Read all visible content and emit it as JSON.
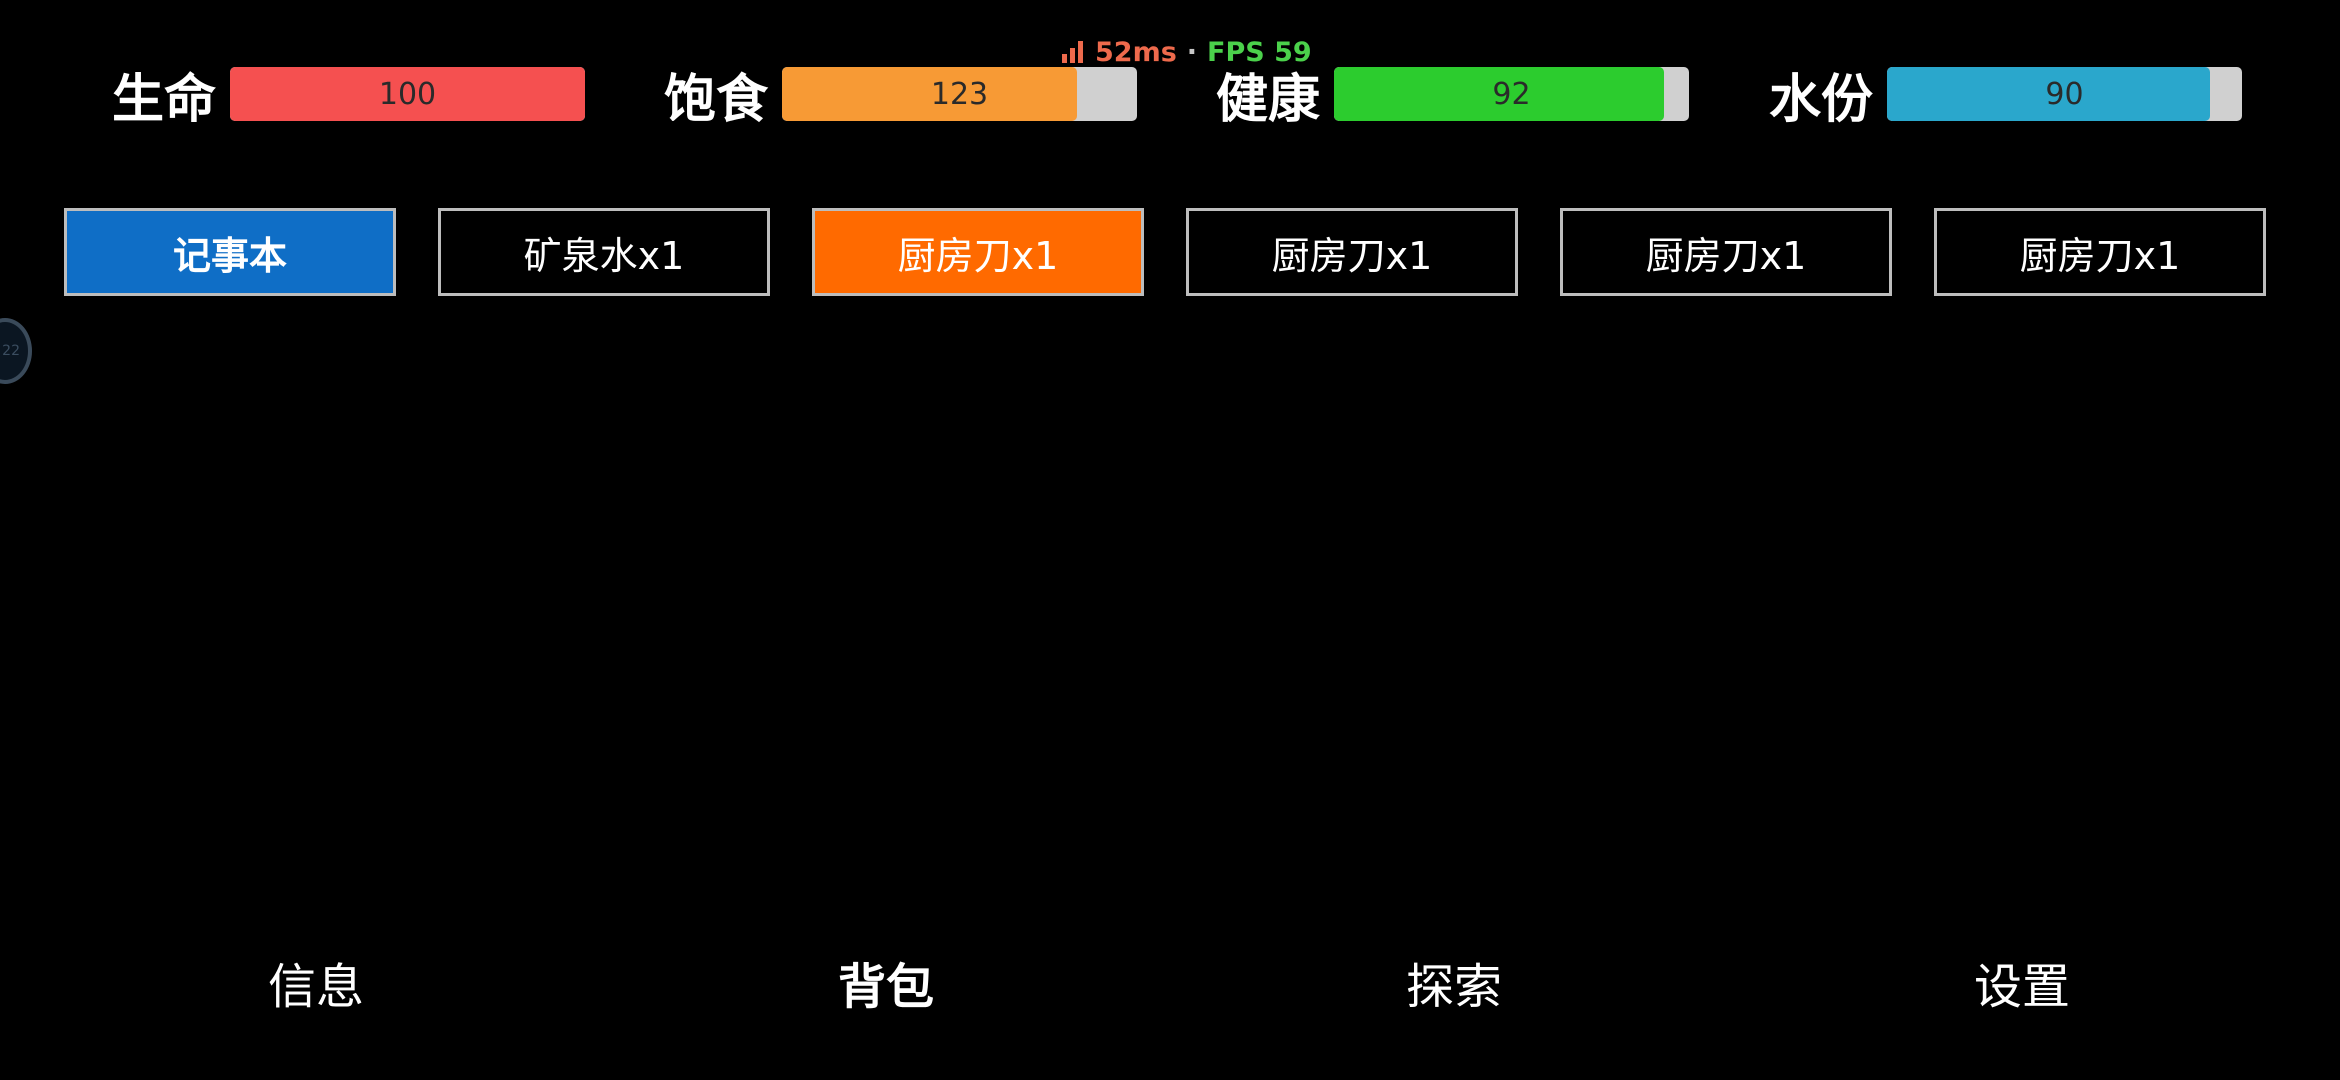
{
  "perf": {
    "ping": "52ms",
    "separator": "·",
    "fps": "FPS 59"
  },
  "stats": [
    {
      "label": "生命",
      "value": "100",
      "fill": 1.0,
      "color": "#f55050"
    },
    {
      "label": "饱食",
      "value": "123",
      "fill": 0.83,
      "color": "#f79a35"
    },
    {
      "label": "健康",
      "value": "92",
      "fill": 0.93,
      "color": "#2ccc2e"
    },
    {
      "label": "水份",
      "value": "90",
      "fill": 0.91,
      "color": "#2aa7cc"
    }
  ],
  "inventory": [
    {
      "label": "记事本"
    },
    {
      "label": "矿泉水x1"
    },
    {
      "label": "厨房刀x1"
    },
    {
      "label": "厨房刀x1"
    },
    {
      "label": "厨房刀x1"
    },
    {
      "label": "厨房刀x1"
    }
  ],
  "side_widget": {
    "text": "22"
  },
  "nav": [
    {
      "label": "信息"
    },
    {
      "label": "背包"
    },
    {
      "label": "探索"
    },
    {
      "label": "设置"
    }
  ],
  "colors": {
    "notebook_active": "#0f6ec6",
    "selected_item": "#ff6a00",
    "signal": "#ee6a4c"
  }
}
